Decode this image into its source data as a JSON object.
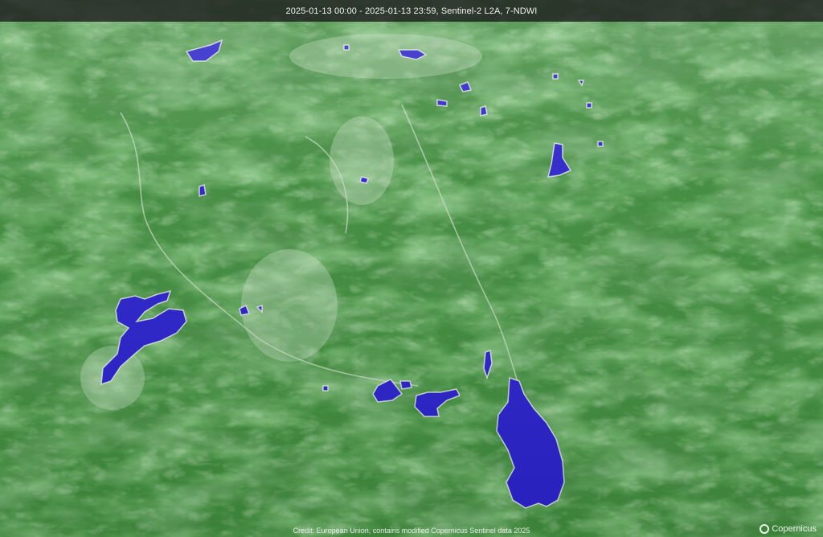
{
  "viewer": {
    "title": "2025-01-13 00:00 - 2025-01-13 23:59, Sentinel-2 L2A, 7-NDWI",
    "credit": "Credit: European Union, contains modified Copernicus Sentinel data 2025",
    "logo_text": "Copernicus"
  },
  "colors": {
    "vegetation": "#3f8a3c",
    "vegetation_light": "#8fce84",
    "water": "#2a22c8",
    "settlement": "#cfe3cc"
  },
  "icons": {
    "logo": "copernicus-logo-icon"
  }
}
